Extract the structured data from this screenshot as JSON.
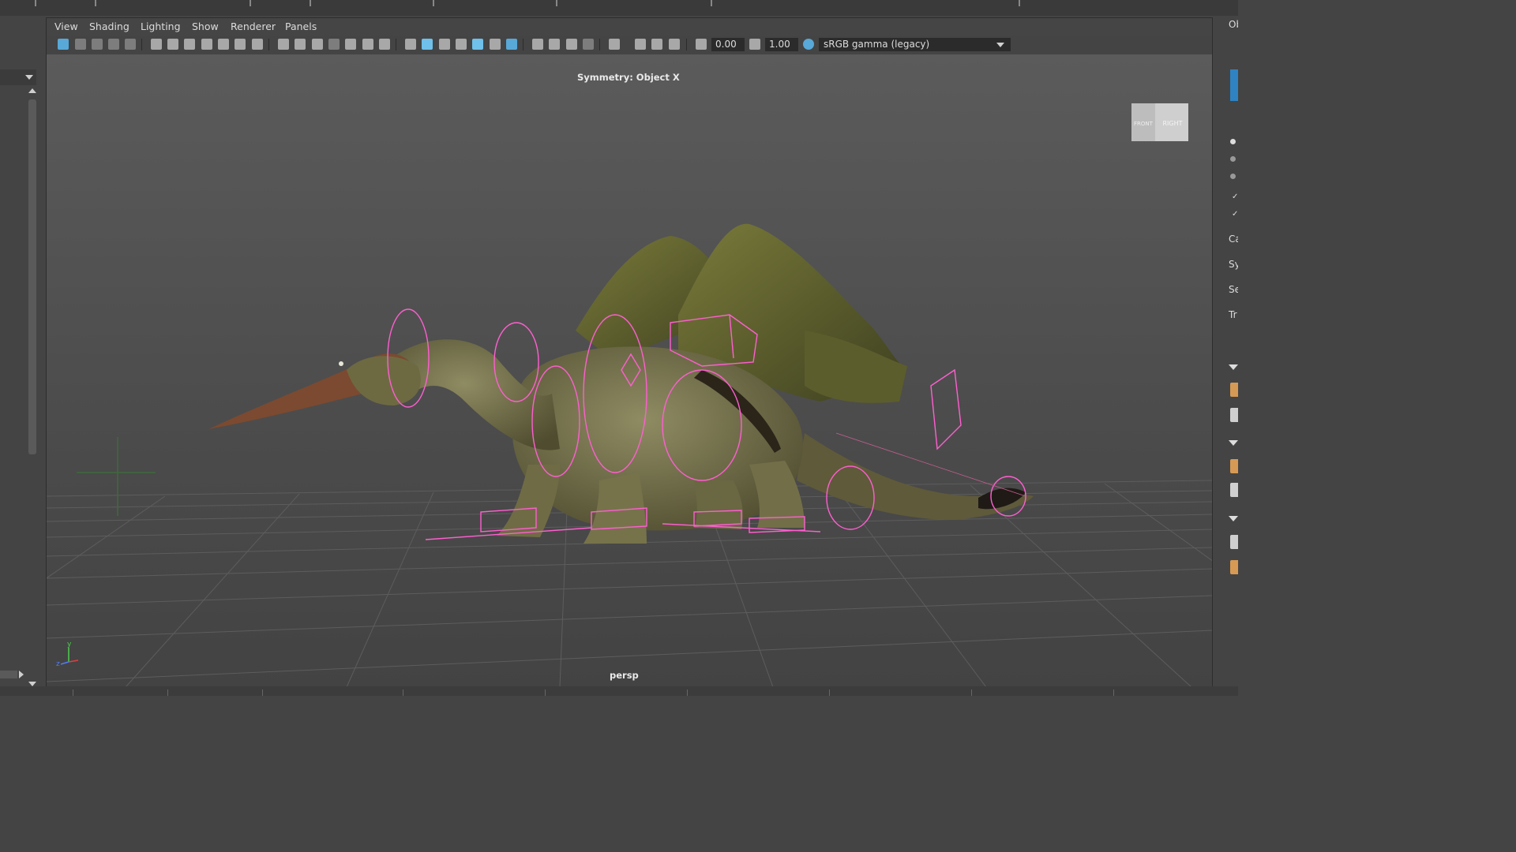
{
  "menu": {
    "items": [
      {
        "id": "view",
        "label": "View"
      },
      {
        "id": "shading",
        "label": "Shading"
      },
      {
        "id": "lighting",
        "label": "Lighting"
      },
      {
        "id": "show",
        "label": "Show"
      },
      {
        "id": "renderer",
        "label": "Renderer"
      },
      {
        "id": "panels",
        "label": "Panels"
      }
    ]
  },
  "toolbar": {
    "exposure_value": "0.00",
    "gamma_value": "1.00",
    "color_space": "sRGB gamma (legacy)"
  },
  "viewport": {
    "symmetry_label": "Symmetry: Object X",
    "camera_label": "persp",
    "viewcube": {
      "front_label": "FRONT",
      "right_label": "RIGHT"
    },
    "axis": {
      "y": "y",
      "z": "z"
    }
  },
  "right_panel": {
    "labels": [
      "Ob",
      "Ca",
      "Sy",
      "Se",
      "Tr"
    ]
  },
  "colors": {
    "viewport_bg_top": "#5b5b5b",
    "viewport_bg_bottom": "#434343",
    "controls": "#ff5fd0",
    "creature": "#6f6c45",
    "accent_blue": "#58a8d8"
  }
}
